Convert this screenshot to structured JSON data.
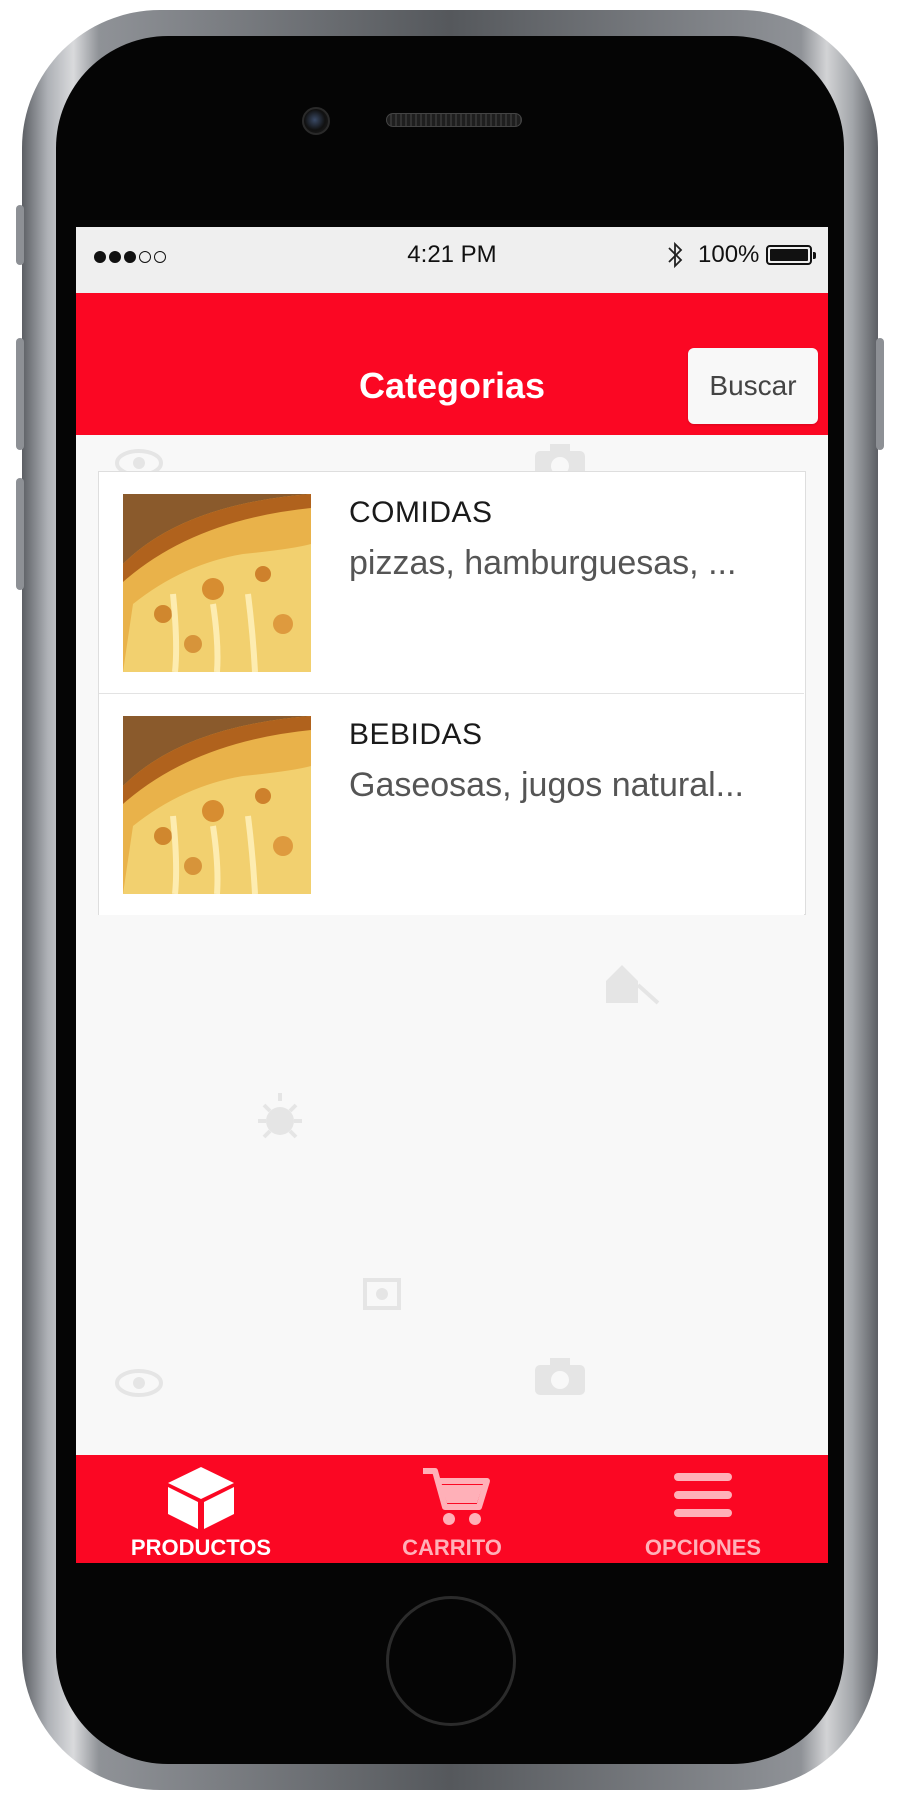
{
  "status_bar": {
    "time": "4:21 PM",
    "battery_percent": "100%",
    "signal_dots_filled": 3,
    "signal_dots_total": 5,
    "icons": [
      "signal-dots-icon",
      "bluetooth-icon",
      "battery-icon"
    ]
  },
  "header": {
    "title": "Categorias",
    "search_label": "Buscar"
  },
  "categories": [
    {
      "title": "COMIDAS",
      "description": "pizzas, hamburguesas, ...",
      "image": "pizza-slice-image"
    },
    {
      "title": "BEBIDAS",
      "description": "Gaseosas, jugos natural...",
      "image": "pizza-slice-image"
    }
  ],
  "tab_bar": {
    "tabs": [
      {
        "label": "PRODUCTOS",
        "icon": "box-icon",
        "active": true
      },
      {
        "label": "CARRITO",
        "icon": "cart-icon",
        "active": false
      },
      {
        "label": "OPCIONES",
        "icon": "hamburger-menu-icon",
        "active": false
      }
    ]
  },
  "colors": {
    "brand_red": "#fb0723",
    "background": "#f8f8f8",
    "inactive_tab": "#ffb0b8"
  }
}
